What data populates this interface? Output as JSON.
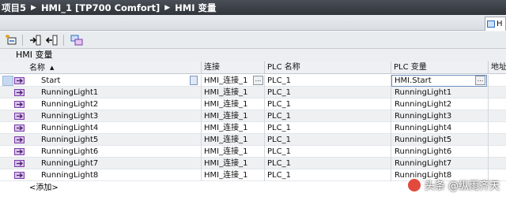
{
  "breadcrumb": [
    "项目5",
    "HMI_1 [TP700 Comfort]",
    "HMI 变量"
  ],
  "tab": {
    "label": "H"
  },
  "section_label": "HMI 变量",
  "columns": {
    "name": "名称",
    "connection": "连接",
    "plc_name": "PLC 名称",
    "plc_tag": "PLC 变量",
    "address": "地址"
  },
  "rows": [
    {
      "name": "Start",
      "connection": "HMI_连接_1",
      "plc_name": "PLC_1",
      "plc_tag": "HMI.Start",
      "ellipsis": "..."
    },
    {
      "name": "RunningLight1",
      "connection": "HMI_连接_1",
      "plc_name": "PLC_1",
      "plc_tag": "RunningLight1"
    },
    {
      "name": "RunningLight2",
      "connection": "HMI_连接_1",
      "plc_name": "PLC_1",
      "plc_tag": "RunningLight2"
    },
    {
      "name": "RunningLight3",
      "connection": "HMI_连接_1",
      "plc_name": "PLC_1",
      "plc_tag": "RunningLight3"
    },
    {
      "name": "RunningLight4",
      "connection": "HMI_连接_1",
      "plc_name": "PLC_1",
      "plc_tag": "RunningLight4"
    },
    {
      "name": "RunningLight5",
      "connection": "HMI_连接_1",
      "plc_name": "PLC_1",
      "plc_tag": "RunningLight5"
    },
    {
      "name": "RunningLight6",
      "connection": "HMI_连接_1",
      "plc_name": "PLC_1",
      "plc_tag": "RunningLight6"
    },
    {
      "name": "RunningLight7",
      "connection": "HMI_连接_1",
      "plc_name": "PLC_1",
      "plc_tag": "RunningLight7"
    },
    {
      "name": "RunningLight8",
      "connection": "HMI_连接_1",
      "plc_name": "PLC_1",
      "plc_tag": "RunningLight8"
    }
  ],
  "add_row": "<添加>",
  "watermark": "头条 @纵雨齐天",
  "colors": {
    "accent": "#2a6cc2",
    "titlebar": "#3a3f46",
    "tag_icon": "#7b3aa8"
  }
}
